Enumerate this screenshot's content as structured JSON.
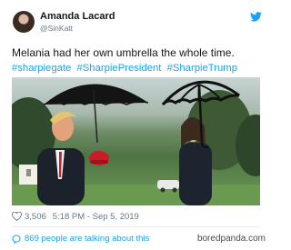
{
  "tweet": {
    "author_name": "Amanda Lacard",
    "author_handle": "@SinKatt",
    "text": "Melania had her own umbrella the whole time.",
    "hashtags": [
      "#sharpiegate",
      "#SharpiePresident",
      "#SharpieTrump"
    ],
    "icons": {
      "brand": "twitter-bird-icon",
      "like": "heart-icon",
      "info": "info-icon",
      "talking": "speech-bubble-icon"
    }
  },
  "stats": {
    "likes": "3,506",
    "time": "5:18 PM - Sep 5, 2019",
    "talking": "869 people are talking about this"
  },
  "site": {
    "watermark": "boredpanda.com"
  },
  "colors": {
    "accent": "#1da1f2",
    "text": "#14171a",
    "muted": "#657786",
    "divider": "#e6ecf0"
  }
}
